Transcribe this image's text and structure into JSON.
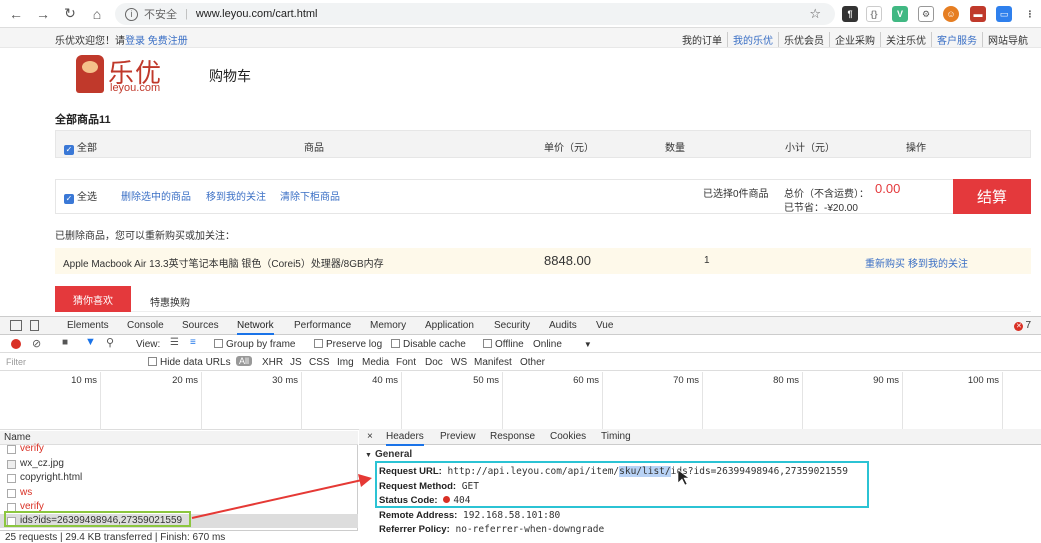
{
  "browser": {
    "insecure": "不安全",
    "url": "www.leyou.com/cart.html"
  },
  "topbar": {
    "welcome": "乐优欢迎您！请",
    "login": "登录",
    "register": "免费注册",
    "links": [
      "我的订单",
      "我的乐优",
      "乐优会员",
      "企业采购",
      "关注乐优",
      "客户服务",
      "网站导航"
    ]
  },
  "logo": {
    "cn": "乐优",
    "en": "leyou.com"
  },
  "page_title": "购物车",
  "all_goods": "全部商品11",
  "cart_head": {
    "all": "全部",
    "goods": "商品",
    "price": "单价（元）",
    "qty": "数量",
    "subtotal": "小计（元）",
    "op": "操作"
  },
  "action_bar": {
    "select_all": "全选",
    "delete_selected": "删除选中的商品",
    "move_follow": "移到我的关注",
    "clear_removed": "清除下柜商品",
    "selected_count": "已选择0件商品",
    "total_label": "总价（不含运费）：",
    "total": "0.00",
    "saved": "已节省：-¥20.00",
    "checkout": "结算"
  },
  "deleted": {
    "tip": "已删除商品，您可以重新购买或加关注：",
    "product": "Apple Macbook Air 13.3英寸笔记本电脑 银色（Corei5）处理器/8GB内存",
    "price": "8848.00",
    "qty": "1",
    "rebuy": "重新购买",
    "follow": "移到我的关注"
  },
  "tabs2": {
    "active": "猜你喜欢",
    "other": "特惠换购"
  },
  "devtools": {
    "tabs": [
      "Elements",
      "Console",
      "Sources",
      "Network",
      "Performance",
      "Memory",
      "Application",
      "Security",
      "Audits",
      "Vue"
    ],
    "active_tab": "Network",
    "errors": "7",
    "toolbar": {
      "view": "View:",
      "group_by_frame": "Group by frame",
      "preserve_log": "Preserve log",
      "disable_cache": "Disable cache",
      "offline": "Offline",
      "online": "Online"
    },
    "filter": {
      "placeholder": "Filter",
      "hide_data_urls": "Hide data URLs",
      "types": [
        "All",
        "XHR",
        "JS",
        "CSS",
        "Img",
        "Media",
        "Font",
        "Doc",
        "WS",
        "Manifest",
        "Other"
      ]
    },
    "timeline": [
      "10 ms",
      "20 ms",
      "30 ms",
      "40 ms",
      "50 ms",
      "60 ms",
      "70 ms",
      "80 ms",
      "90 ms",
      "100 ms"
    ],
    "name_header": "Name",
    "requests": [
      {
        "name": "verify",
        "color": "red"
      },
      {
        "name": "wx_cz.jpg",
        "color": "normal"
      },
      {
        "name": "copyright.html",
        "color": "normal"
      },
      {
        "name": "ws",
        "color": "red"
      },
      {
        "name": "verify",
        "color": "red"
      },
      {
        "name": "ids?ids=26399498946,27359021559",
        "color": "selected"
      }
    ],
    "status": "25 requests | 29.4 KB transferred | Finish: 670 ms",
    "detail_tabs": [
      "×",
      "Headers",
      "Preview",
      "Response",
      "Cookies",
      "Timing"
    ],
    "general": "General",
    "request_url_label": "Request URL:",
    "request_url_pre": "http://api.leyou.com/api/item/",
    "request_url_sel": "sku/list/",
    "request_url_post": "ids?ids=26399498946,27359021559",
    "method_label": "Request Method:",
    "method": "GET",
    "status_label": "Status Code:",
    "status_code": "404",
    "remote_label": "Remote Address:",
    "remote": "192.168.58.101:80",
    "referrer_label": "Referrer Policy:",
    "referrer": "no-referrer-when-downgrade"
  }
}
